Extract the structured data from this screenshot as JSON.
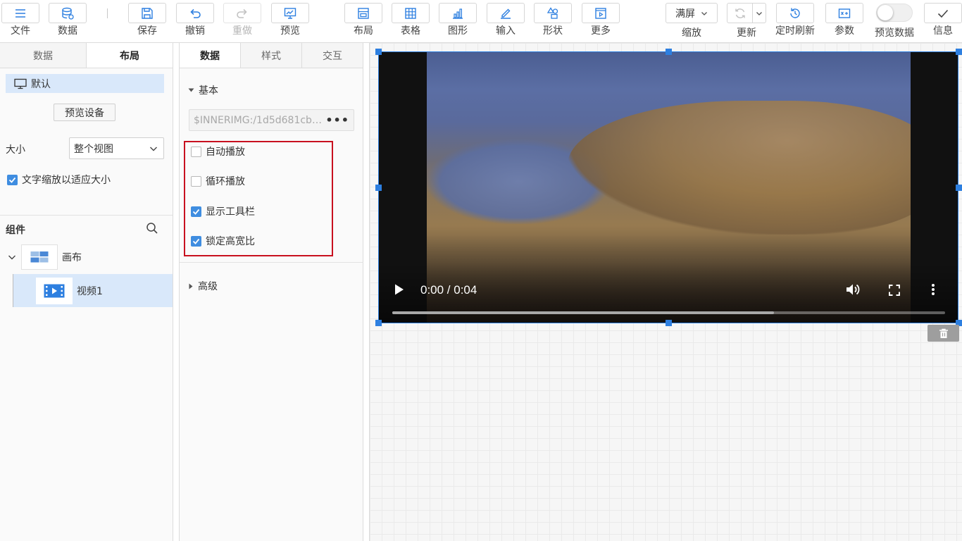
{
  "toolbar": {
    "file": "文件",
    "data": "数据",
    "save": "保存",
    "undo": "撤销",
    "redo": "重做",
    "preview": "预览",
    "layout": "布局",
    "table": "表格",
    "graph": "图形",
    "input": "输入",
    "shape": "形状",
    "more": "更多",
    "zoom_value": "满屏",
    "zoom_label": "缩放",
    "update": "更新",
    "timed_refresh": "定时刷新",
    "params": "参数",
    "preview_data": "预览数据",
    "info": "信息",
    "accent_color": "#2d7fe0"
  },
  "left_panel": {
    "tabs": [
      "数据",
      "布局"
    ],
    "active_tab": "布局",
    "device_default": "默认",
    "preview_device_button": "预览设备",
    "size_label": "大小",
    "size_value": "整个视图",
    "fit_text_label": "文字缩放以适应大小",
    "fit_text_checked": true,
    "components_title": "组件",
    "tree": {
      "canvas_label": "画布",
      "video_label": "视频1"
    }
  },
  "props_panel": {
    "tabs": [
      "数据",
      "样式",
      "交互"
    ],
    "active_tab": "数据",
    "basic_section": "基本",
    "image_path": "$INNERIMG:/1d5d681cb0...",
    "options": [
      {
        "label": "自动播放",
        "checked": false
      },
      {
        "label": "循环播放",
        "checked": false
      },
      {
        "label": "显示工具栏",
        "checked": true
      },
      {
        "label": "锁定高宽比",
        "checked": true
      }
    ],
    "advanced_section": "高级",
    "highlight_color": "#c8101f"
  },
  "video": {
    "time": "0:00 / 0:04",
    "progress_fraction": 0.69
  }
}
